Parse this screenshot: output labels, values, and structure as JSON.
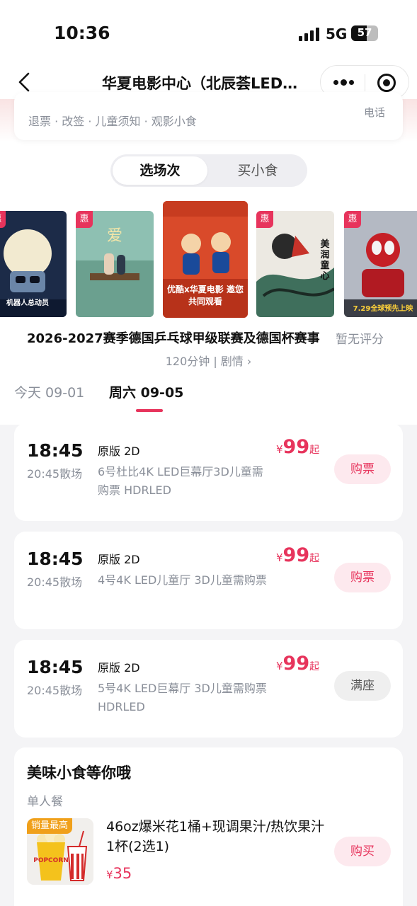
{
  "status_bar": {
    "time": "10:36",
    "network": "5G",
    "battery": "57",
    "battery_level": 0.57
  },
  "nav": {
    "title": "华夏电影中心（北辰荟LED…"
  },
  "cinema": {
    "services": "退票 · 改签 · 儿童须知 · 观影小食",
    "phone_label": "电话"
  },
  "tabs": [
    {
      "label": "选场次",
      "active": true
    },
    {
      "label": "买小食",
      "active": false
    }
  ],
  "posters": [
    {
      "name": "wall-e-poster",
      "badge": "惠",
      "caption": "机器人总动员",
      "bg": "#1e2d4a"
    },
    {
      "name": "romance-poster",
      "badge": "惠",
      "caption": "",
      "bg": "#7fb2a4"
    },
    {
      "name": "tabletennis-poster",
      "badge": "",
      "caption": "优酷x华夏电影 邀您共同观看",
      "bg": "#d1462b"
    },
    {
      "name": "ink-poster",
      "badge": "惠",
      "caption": "美润童心",
      "bg": "#e9e6df"
    },
    {
      "name": "spiderman-poster",
      "badge": "惠",
      "caption": "7.29全球预先上映",
      "bg": "#b8bcc6"
    }
  ],
  "movie": {
    "title": "2026-2027赛季德国乒乓球甲级联赛及德国杯赛事",
    "rating": "暂无评分",
    "meta": "120分钟 | 剧情 ›"
  },
  "dates": [
    {
      "label": "今天 09-01",
      "active": false
    },
    {
      "label": "周六 09-05",
      "active": true
    }
  ],
  "showtimes": [
    {
      "start": "18:45",
      "end": "20:45散场",
      "version": "原版 2D",
      "hall": "6号杜比4K LED巨幕厅3D儿童需购票 HDRLED",
      "currency": "¥",
      "price": "99",
      "price_suffix": "起",
      "button": "购票",
      "button_type": "buy"
    },
    {
      "start": "18:45",
      "end": "20:45散场",
      "version": "原版 2D",
      "hall": "4号4K LED儿童厅 3D儿童需购票",
      "currency": "¥",
      "price": "99",
      "price_suffix": "起",
      "button": "购票",
      "button_type": "buy"
    },
    {
      "start": "18:45",
      "end": "20:45散场",
      "version": "原版 2D",
      "hall": "5号4K LED巨幕厅 3D儿童需购票 HDRLED",
      "currency": "¥",
      "price": "99",
      "price_suffix": "起",
      "button": "满座",
      "button_type": "full"
    }
  ],
  "snacks": {
    "title": "美味小食等你哦",
    "category": "单人餐",
    "item": {
      "badge": "销量最高",
      "name": "46oz爆米花1桶+现调果汁/热饮果汁1杯(2选1)",
      "currency": "¥",
      "price": "35",
      "button": "购买",
      "image_text": "POPCORN"
    }
  },
  "colors": {
    "accent": "#e7345c",
    "muted": "#8a8f99",
    "badge_orange": "#f0a01a"
  }
}
